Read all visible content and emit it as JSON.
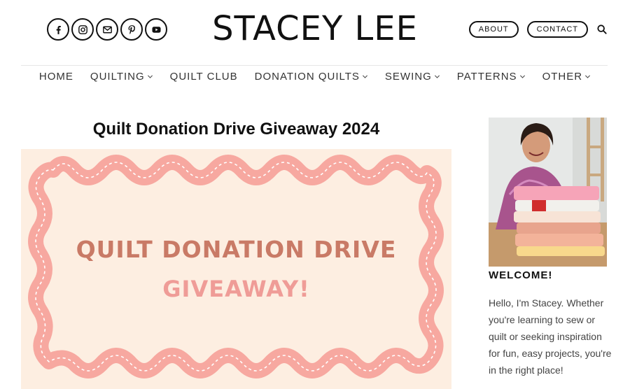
{
  "header": {
    "site_title": "STACEY LEE",
    "social": [
      {
        "name": "facebook-icon"
      },
      {
        "name": "instagram-icon"
      },
      {
        "name": "email-icon"
      },
      {
        "name": "pinterest-icon"
      },
      {
        "name": "youtube-icon"
      }
    ],
    "about_label": "ABOUT",
    "contact_label": "CONTACT",
    "search_icon": "search-icon"
  },
  "nav": {
    "items": [
      {
        "label": "HOME",
        "dropdown": false
      },
      {
        "label": "QUILTING",
        "dropdown": true
      },
      {
        "label": "QUILT CLUB",
        "dropdown": false
      },
      {
        "label": "DONATION QUILTS",
        "dropdown": true
      },
      {
        "label": "SEWING",
        "dropdown": true
      },
      {
        "label": "PATTERNS",
        "dropdown": true
      },
      {
        "label": "OTHER",
        "dropdown": true
      }
    ]
  },
  "post": {
    "title": "Quilt Donation Drive Giveaway 2024",
    "hero": {
      "line1": "QUILT DONATION DRIVE",
      "line2": "GIVEAWAY!",
      "colors": {
        "background": "#fdeee1",
        "frame": "#f7a8a0",
        "line1": "#c97a66",
        "line2": "#ef9c97"
      }
    }
  },
  "sidebar": {
    "heading": "WELCOME!",
    "intro": "Hello, I'm Stacey. Whether you're learning to sew or quilt or seeking inspiration for fun, easy projects, you're in the right place!"
  }
}
